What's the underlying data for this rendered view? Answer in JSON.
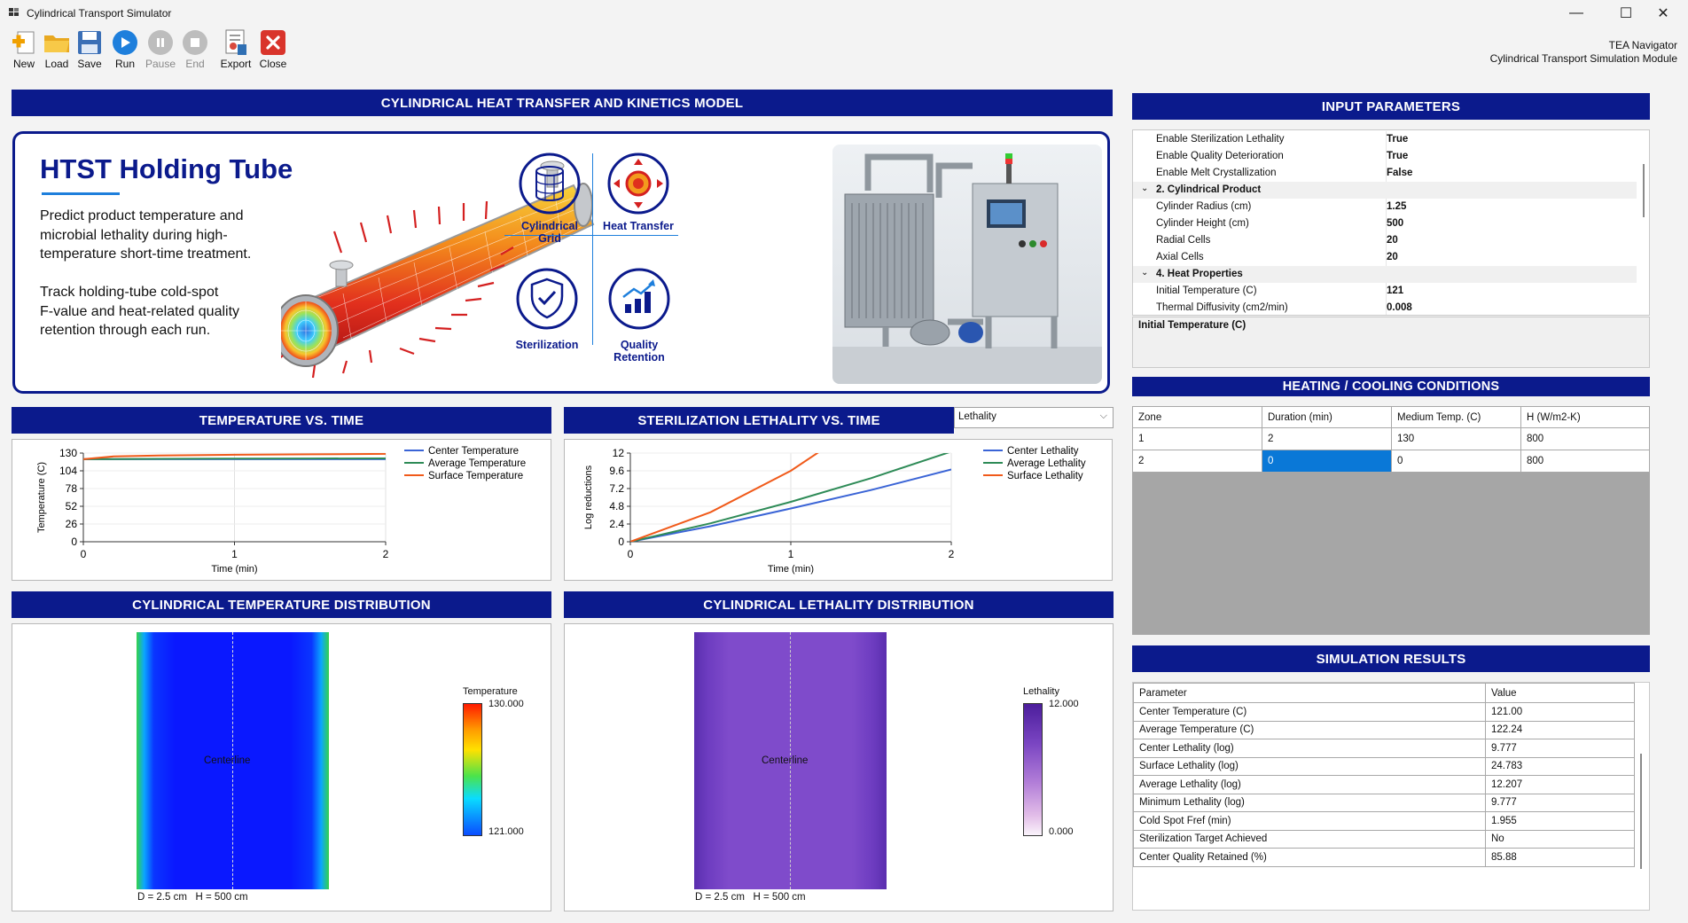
{
  "window": {
    "title": "Cylindrical Transport Simulator",
    "minimize": "—",
    "maximize": "☐",
    "close": "✕"
  },
  "toolbar": {
    "new": "New",
    "load": "Load",
    "save": "Save",
    "run": "Run",
    "pause": "Pause",
    "end": "End",
    "export": "Export",
    "close": "Close",
    "nav_title": "TEA Navigator",
    "nav_subtitle": "Cylindrical Transport Simulation Module"
  },
  "headers": {
    "model": "CYLINDRICAL HEAT TRANSFER AND KINETICS MODEL",
    "input": "INPUT PARAMETERS",
    "temp_time": "TEMPERATURE VS. TIME",
    "leth_time": "STERILIZATION LETHALITY VS. TIME",
    "conditions": "HEATING / COOLING CONDITIONS",
    "temp_dist": "CYLINDRICAL TEMPERATURE DISTRIBUTION",
    "leth_dist": "CYLINDRICAL LETHALITY DISTRIBUTION",
    "results": "SIMULATION RESULTS"
  },
  "banner": {
    "title": "HTST Holding Tube",
    "para1": [
      "Predict product temperature and",
      "microbial lethality during high-",
      "temperature short-time treatment."
    ],
    "para2": [
      "Track holding-tube cold-spot",
      "F-value and heat-related quality",
      "retention through each run."
    ],
    "features": [
      "Cylindrical Grid",
      "Heat Transfer",
      "Sterilization",
      "Quality Retention"
    ]
  },
  "properties": {
    "rows": [
      {
        "k": "Enable Sterilization Lethality",
        "v": "True"
      },
      {
        "k": "Enable Quality Deterioration",
        "v": "True"
      },
      {
        "k": "Enable Melt Crystallization",
        "v": "False"
      },
      {
        "cat": true,
        "k": "2. Cylindrical Product"
      },
      {
        "k": "Cylinder Radius (cm)",
        "v": "1.25"
      },
      {
        "k": "Cylinder Height (cm)",
        "v": "500"
      },
      {
        "k": "Radial Cells",
        "v": "20"
      },
      {
        "k": "Axial Cells",
        "v": "20"
      },
      {
        "cat": true,
        "k": "4. Heat Properties"
      },
      {
        "k": "Initial Temperature (C)",
        "v": "121"
      },
      {
        "k": "Thermal Diffusivity (cm2/min)",
        "v": "0.008"
      }
    ],
    "description": "Initial Temperature (C)"
  },
  "lethality_select": "Lethality",
  "conditions": {
    "columns": [
      "Zone",
      "Duration (min)",
      "Medium Temp. (C)",
      "H (W/m2-K)"
    ],
    "rows": [
      [
        "1",
        "2",
        "130",
        "800"
      ],
      [
        "2",
        "0",
        "0",
        "800"
      ]
    ]
  },
  "results": {
    "columns": [
      "Parameter",
      "Value"
    ],
    "rows": [
      [
        "Center Temperature (C)",
        "121.00"
      ],
      [
        "Average Temperature (C)",
        "122.24"
      ],
      [
        "Center Lethality (log)",
        "9.777"
      ],
      [
        "Surface Lethality (log)",
        "24.783"
      ],
      [
        "Average Lethality (log)",
        "12.207"
      ],
      [
        "Minimum Lethality (log)",
        "9.777"
      ],
      [
        "Cold Spot Fref (min)",
        "1.955"
      ],
      [
        "Sterilization Target Achieved",
        "No"
      ],
      [
        "Center Quality Retained (%)",
        "85.88"
      ]
    ]
  },
  "temp_dist": {
    "centerline": "Centerline",
    "caption": "D = 2.5 cm   H = 500 cm",
    "scale_title": "Temperature",
    "scale_max": "130.000",
    "scale_min": "121.000"
  },
  "leth_dist": {
    "centerline": "Centerline",
    "caption": "D = 2.5 cm   H = 500 cm",
    "scale_title": "Lethality",
    "scale_max": "12.000",
    "scale_min": "0.000"
  },
  "chart_data": [
    {
      "type": "line",
      "ylabel": "Temperature (C)",
      "xlabel": "Time (min)",
      "yticks": [
        "0",
        "26",
        "52",
        "78",
        "104",
        "130"
      ],
      "xticks": [
        "0",
        "1",
        "2"
      ],
      "ylim": [
        0,
        130
      ],
      "xlim": [
        0,
        2
      ],
      "series": [
        {
          "name": "Center Temperature",
          "color": "#3a64d6",
          "x": [
            0,
            0.5,
            1,
            1.5,
            2
          ],
          "values": [
            121,
            121,
            121,
            121,
            121
          ]
        },
        {
          "name": "Average Temperature",
          "color": "#2e8b57",
          "x": [
            0,
            0.5,
            1,
            1.5,
            2
          ],
          "values": [
            121,
            121.6,
            121.9,
            122.1,
            122.24
          ]
        },
        {
          "name": "Surface Temperature",
          "color": "#f05a1a",
          "x": [
            0,
            0.2,
            0.5,
            1,
            1.5,
            2
          ],
          "values": [
            121,
            125,
            126.5,
            127.5,
            128.2,
            128.8
          ]
        }
      ]
    },
    {
      "type": "line",
      "ylabel": "Log reductions",
      "xlabel": "Time (min)",
      "yticks": [
        "0",
        "2.4",
        "4.8",
        "7.2",
        "9.6",
        "12"
      ],
      "xticks": [
        "0",
        "1",
        "2"
      ],
      "ylim": [
        0,
        12
      ],
      "xlim": [
        0,
        2
      ],
      "series": [
        {
          "name": "Center Lethality",
          "color": "#3a64d6",
          "x": [
            0,
            0.5,
            1,
            1.5,
            2
          ],
          "values": [
            0,
            2.1,
            4.5,
            7.0,
            9.777
          ]
        },
        {
          "name": "Average Lethality",
          "color": "#2e8b57",
          "x": [
            0,
            0.5,
            1,
            1.5,
            2
          ],
          "values": [
            0,
            2.5,
            5.4,
            8.6,
            12.207
          ]
        },
        {
          "name": "Surface Lethality",
          "color": "#f05a1a",
          "x": [
            0,
            0.5,
            1,
            1.2,
            1.5,
            2
          ],
          "values": [
            0,
            4.0,
            9.6,
            12.5,
            17.0,
            24.783
          ]
        }
      ]
    }
  ]
}
